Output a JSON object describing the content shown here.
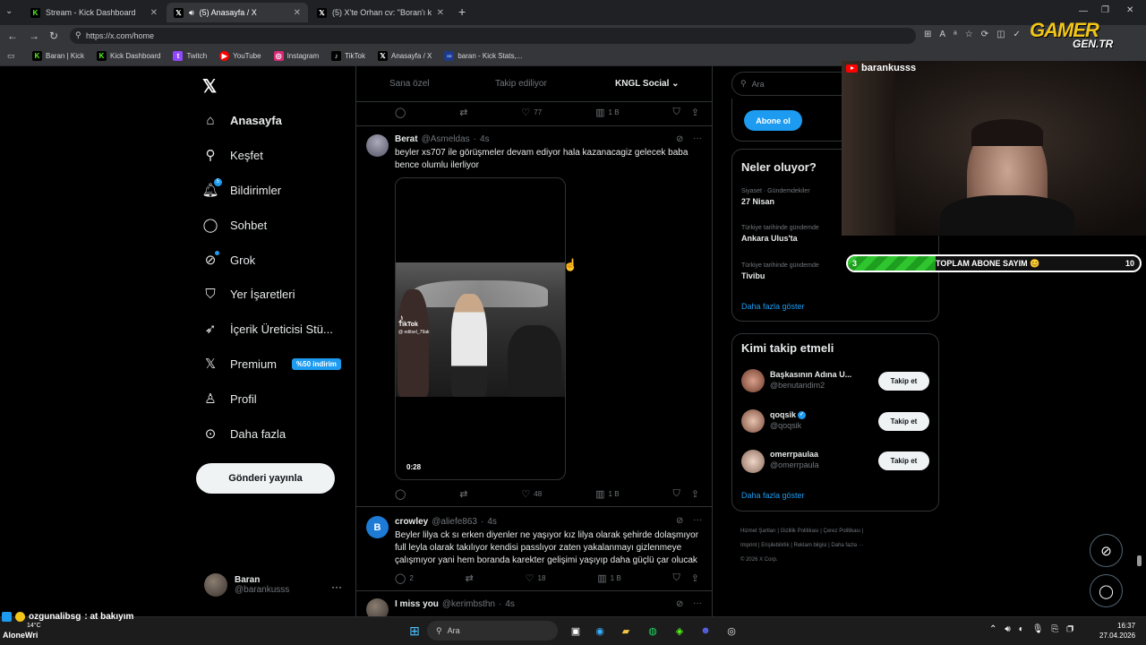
{
  "browser": {
    "tabs": [
      {
        "title": "Stream - Kick Dashboard",
        "icon": "kick-icon"
      },
      {
        "title": "(5) Anasayfa / X",
        "icon": "x-icon"
      },
      {
        "title": "(5) X'te Orhan cv: \"Boran'ı kaçırıp l...",
        "icon": "x-icon"
      }
    ],
    "url": "https://x.com/home",
    "bookmarks": [
      "Baran | Kick",
      "Kick Dashboard",
      "Twitch",
      "YouTube",
      "Instagram",
      "TikTok",
      "Anasayfa / X",
      "baran - Kick Stats,..."
    ]
  },
  "nav": {
    "items": [
      "Anasayfa",
      "Keşfet",
      "Bildirimler",
      "Sohbet",
      "Grok",
      "Yer İşaretleri",
      "İçerik Üreticisi Stü...",
      "Premium",
      "Profil",
      "Daha fazla"
    ],
    "notif_badge": "5",
    "premium_badge": "%50 indirim",
    "post_button": "Gönderi yayınla",
    "user_name": "Baran",
    "user_handle": "@barankusss"
  },
  "feed": {
    "tabs": [
      "Sana özel",
      "Takip ediliyor",
      "KNGL Social"
    ],
    "top_actions": {
      "likes": "77",
      "views": "1 B"
    },
    "tweets": [
      {
        "name": "Berat",
        "handle": "@Asmeldas",
        "time": "4s",
        "text": "beyler xs707  ile görüşmeler devam ediyor hala kazanacagiz gelecek baba bence olumlu ilerliyor",
        "video_duration": "0:28",
        "tiktok_label": "TikTok",
        "tiktok_user": "@ editsel_79ak",
        "likes": "48",
        "views": "1 B"
      },
      {
        "name": "crowley",
        "handle": "@aliefe863",
        "time": "4s",
        "avatar_letter": "B",
        "text": "Beyler lilya ck sı erken diyenler ne yaşıyor kız lilya olarak şehirde dolaşmıyor full leyla olarak takılıyor kendisi passlıyor zaten yakalanmayı gizlenmeye çalışmıyor yani hem boranda karekter gelişimi yaşıyıp daha güçlü çar olucak",
        "replies": "2",
        "likes": "18",
        "views": "1 B"
      },
      {
        "name": "I miss you",
        "handle": "@kerimbsthn",
        "time": "4s"
      }
    ]
  },
  "right": {
    "search_placeholder": "Ara",
    "subscribe_button": "Abone ol",
    "trends_title": "Neler oluyor?",
    "trends": [
      {
        "context": "Siyaset · Gündemdekiler",
        "name": "27 Nisan"
      },
      {
        "context": "Türkiye tarihinde gündemde",
        "name": "Ankara Ulus'ta"
      },
      {
        "context": "Türkiye tarihinde gündemde",
        "name": "Tivibu"
      }
    ],
    "show_more": "Daha fazla göster",
    "who_title": "Kimi takip etmeli",
    "who": [
      {
        "name": "Başkasının Adına U...",
        "handle": "@benutandim2",
        "verified": false
      },
      {
        "name": "qoqsik",
        "handle": "@qoqsik",
        "verified": true
      },
      {
        "name": "omerrpaulaa",
        "handle": "@omerrpaula",
        "verified": false
      }
    ],
    "follow_button": "Takip et",
    "footer_line1": [
      "Hizmet Şartları",
      "Gizlilik Politikası",
      "Çerez Politikası"
    ],
    "footer_line2": [
      "Imprint",
      "Erişilebilirlik",
      "Reklam bilgisi",
      "Daha fazla ···"
    ],
    "copyright": "© 2026 X Corp."
  },
  "overlay": {
    "streamer": "barankusss",
    "sub_label": "TOPLAM ABONE SAYIM 😊",
    "sub_current": 3,
    "sub_goal": 10,
    "logo_top": "GAMER",
    "logo_bottom": "GEN.TR"
  },
  "taskbar": {
    "chat_user": "ozgunalibsg",
    "chat_msg": ": at bakıyım",
    "chat_user2": "AloneWri",
    "weather_temp": "14°C",
    "search": "Ara",
    "time": "16:37",
    "date": "27.04.2026"
  }
}
